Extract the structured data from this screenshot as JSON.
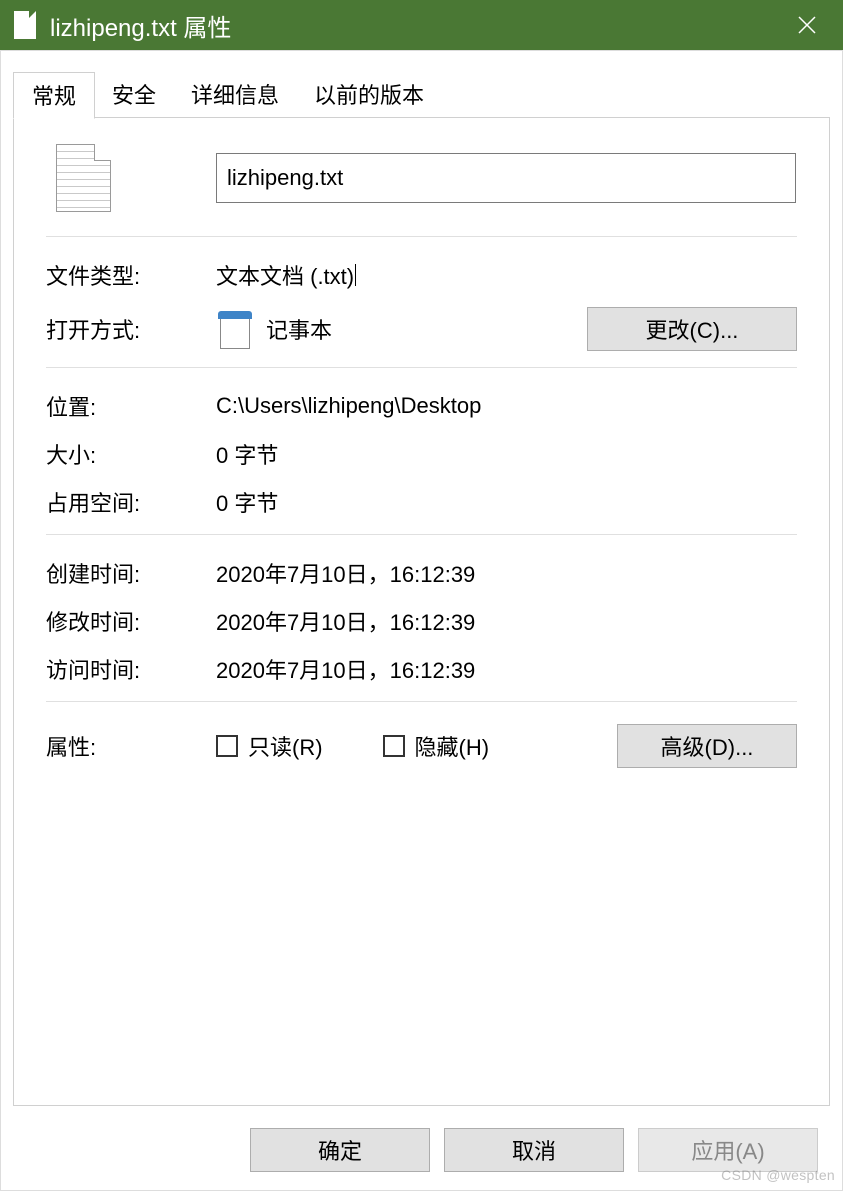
{
  "title": "lizhipeng.txt 属性",
  "tabs": {
    "general": "常规",
    "security": "安全",
    "details": "详细信息",
    "previous": "以前的版本"
  },
  "general": {
    "filename": "lizhipeng.txt",
    "filetype_label": "文件类型:",
    "filetype_value": "文本文档 (.txt)",
    "opens_with_label": "打开方式:",
    "opens_with_value": "记事本",
    "change_btn": "更改(C)...",
    "location_label": "位置:",
    "location_value": "C:\\Users\\lizhipeng\\Desktop",
    "size_label": "大小:",
    "size_value": "0 字节",
    "disk_label": "占用空间:",
    "disk_value": "0 字节",
    "created_label": "创建时间:",
    "created_value": "2020年7月10日，16:12:39",
    "modified_label": "修改时间:",
    "modified_value": "2020年7月10日，16:12:39",
    "accessed_label": "访问时间:",
    "accessed_value": "2020年7月10日，16:12:39",
    "attributes_label": "属性:",
    "readonly_label": "只读(R)",
    "hidden_label": "隐藏(H)",
    "advanced_btn": "高级(D)..."
  },
  "footer": {
    "ok": "确定",
    "cancel": "取消",
    "apply": "应用(A)"
  },
  "watermark": "CSDN @wespten"
}
